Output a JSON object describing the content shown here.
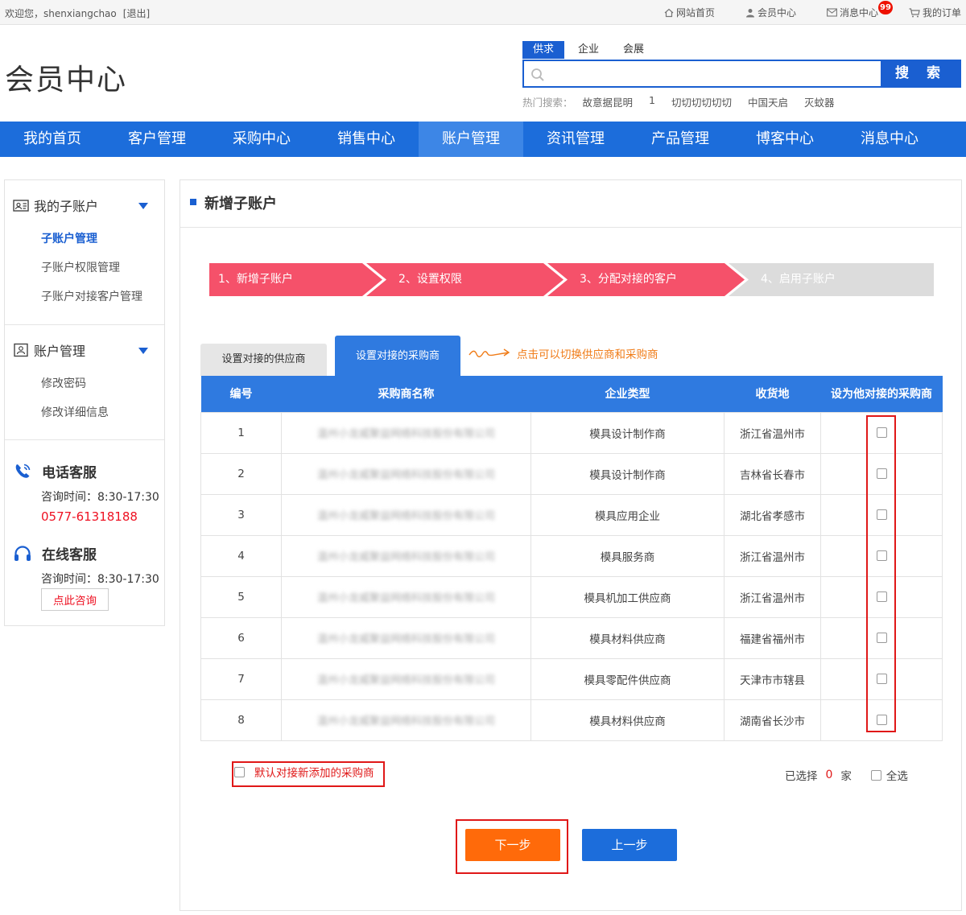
{
  "topbar": {
    "welcome": "欢迎您，shenxiangchao",
    "logout": "[退出]",
    "links": [
      {
        "label": "网站首页",
        "icon": "home-icon"
      },
      {
        "label": "会员中心",
        "icon": "user-icon"
      },
      {
        "label": "消息中心",
        "icon": "mail-icon",
        "badge": "99"
      },
      {
        "label": "我的订单",
        "icon": "cart-icon"
      }
    ]
  },
  "header": {
    "logo": "会员中心",
    "search_tabs": [
      "供求",
      "企业",
      "会展"
    ],
    "search_button": "搜 索",
    "hot_label": "热门搜索：",
    "hot_keywords": [
      "故意据昆明",
      "1",
      "切切切切切切",
      "中国天启",
      "灭蚊器"
    ]
  },
  "nav": [
    "我的首页",
    "客户管理",
    "采购中心",
    "销售中心",
    "账户管理",
    "资讯管理",
    "产品管理",
    "博客中心",
    "消息中心"
  ],
  "sidebar": {
    "group1": {
      "title": "我的子账户",
      "items": [
        "子账户管理",
        "子账户权限管理",
        "子账户对接客户管理"
      ]
    },
    "group2": {
      "title": "账户管理",
      "items": [
        "修改密码",
        "修改详细信息"
      ]
    },
    "phone_service": {
      "title": "电话客服",
      "hours": "咨询时间：8:30-17:30",
      "phone": "0577-61318188"
    },
    "online_service": {
      "title": "在线客服",
      "hours": "咨询时间：8:30-17:30",
      "button": "点此咨询"
    }
  },
  "main": {
    "title": "新增子账户",
    "steps": [
      "1、新增子账户",
      "2、设置权限",
      "3、分配对接的客户",
      "4、启用子账户"
    ],
    "tabs": [
      "设置对接的供应商",
      "设置对接的采购商"
    ],
    "hint": "点击可以切换供应商和采购商",
    "columns": [
      "编号",
      "采购商名称",
      "企业类型",
      "收货地",
      "设为他对接的采购商"
    ],
    "rows": [
      {
        "no": "1",
        "name": "温州小龙威聚益网络科技股份有限公司",
        "type": "模具设计制作商",
        "location": "浙江省温州市"
      },
      {
        "no": "2",
        "name": "温州小龙威聚益网络科技股份有限公司",
        "type": "模具设计制作商",
        "location": "吉林省长春市"
      },
      {
        "no": "3",
        "name": "温州小龙威聚益网络科技股份有限公司",
        "type": "模具应用企业",
        "location": "湖北省孝感市"
      },
      {
        "no": "4",
        "name": "温州小龙威聚益网络科技股份有限公司",
        "type": "模具服务商",
        "location": "浙江省温州市"
      },
      {
        "no": "5",
        "name": "温州小龙威聚益网络科技股份有限公司",
        "type": "模具机加工供应商",
        "location": "浙江省温州市"
      },
      {
        "no": "6",
        "name": "温州小龙威聚益网络科技股份有限公司",
        "type": "模具材料供应商",
        "location": "福建省福州市"
      },
      {
        "no": "7",
        "name": "温州小龙威聚益网络科技股份有限公司",
        "type": "模具零配件供应商",
        "location": "天津市市辖县"
      },
      {
        "no": "8",
        "name": "温州小龙威聚益网络科技股份有限公司",
        "type": "模具材料供应商",
        "location": "湖南省长沙市"
      }
    ],
    "default_option": "默认对接新添加的采购商",
    "selected_prefix": "已选择",
    "selected_count": "0",
    "selected_suffix": "家",
    "select_all": "全选",
    "next_button": "下一步",
    "prev_button": "上一步"
  },
  "colors": {
    "primary": "#1c6ddb",
    "step_active": "#f5516a",
    "step_inactive": "#dcdcdc",
    "next": "#ff6a0a",
    "highlight": "#e01818"
  }
}
